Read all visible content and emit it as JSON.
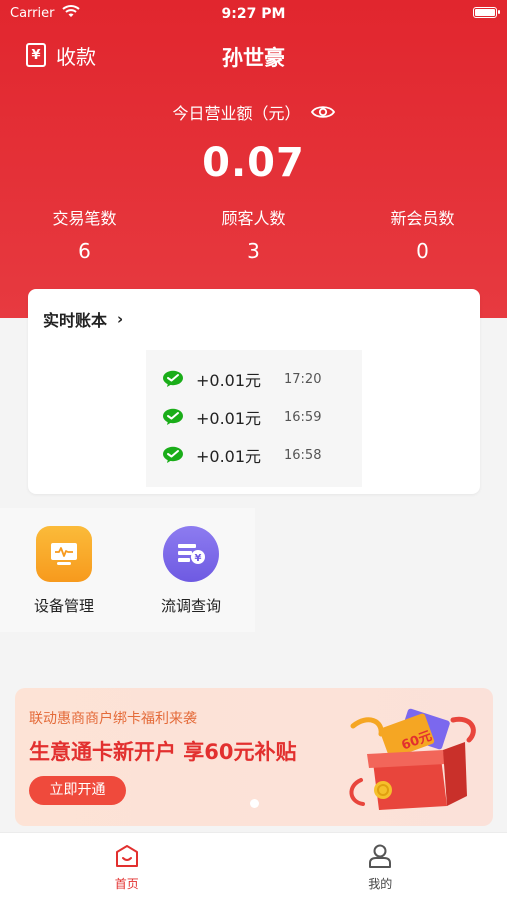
{
  "status_bar": {
    "carrier": "Carrier",
    "time": "9:27 PM"
  },
  "header": {
    "collect_icon_glyph": "¥",
    "collect_label": "收款",
    "store_name": "孙世豪"
  },
  "revenue": {
    "label": "今日营业额（元）",
    "value": "0.07"
  },
  "stats": [
    {
      "label": "交易笔数",
      "value": "6"
    },
    {
      "label": "顾客人数",
      "value": "3"
    },
    {
      "label": "新会员数",
      "value": "0"
    }
  ],
  "ledger": {
    "title": "实时账本",
    "transactions": [
      {
        "icon": "wechat-pay-icon",
        "amount": "+0.01元",
        "time": "17:20"
      },
      {
        "icon": "wechat-pay-icon",
        "amount": "+0.01元",
        "time": "16:59"
      },
      {
        "icon": "wechat-pay-icon",
        "amount": "+0.01元",
        "time": "16:58"
      }
    ]
  },
  "tools": [
    {
      "icon": "monitor-icon",
      "label": "设备管理"
    },
    {
      "icon": "bill-query-icon",
      "label": "流调查询"
    }
  ],
  "banner": {
    "subtitle": "联动惠商商户绑卡福利来袭",
    "title": "生意通卡新开户 享60元补贴",
    "button_label": "立即开通",
    "art_text": "60元"
  },
  "tabbar": [
    {
      "icon": "home-icon",
      "label": "首页",
      "active": true
    },
    {
      "icon": "profile-icon",
      "label": "我的",
      "active": false
    }
  ],
  "colors": {
    "brand_red": "#e1262e",
    "wechat_green": "#1aad19",
    "device_orange": "#f9a826",
    "flow_purple": "#7b68ee"
  }
}
